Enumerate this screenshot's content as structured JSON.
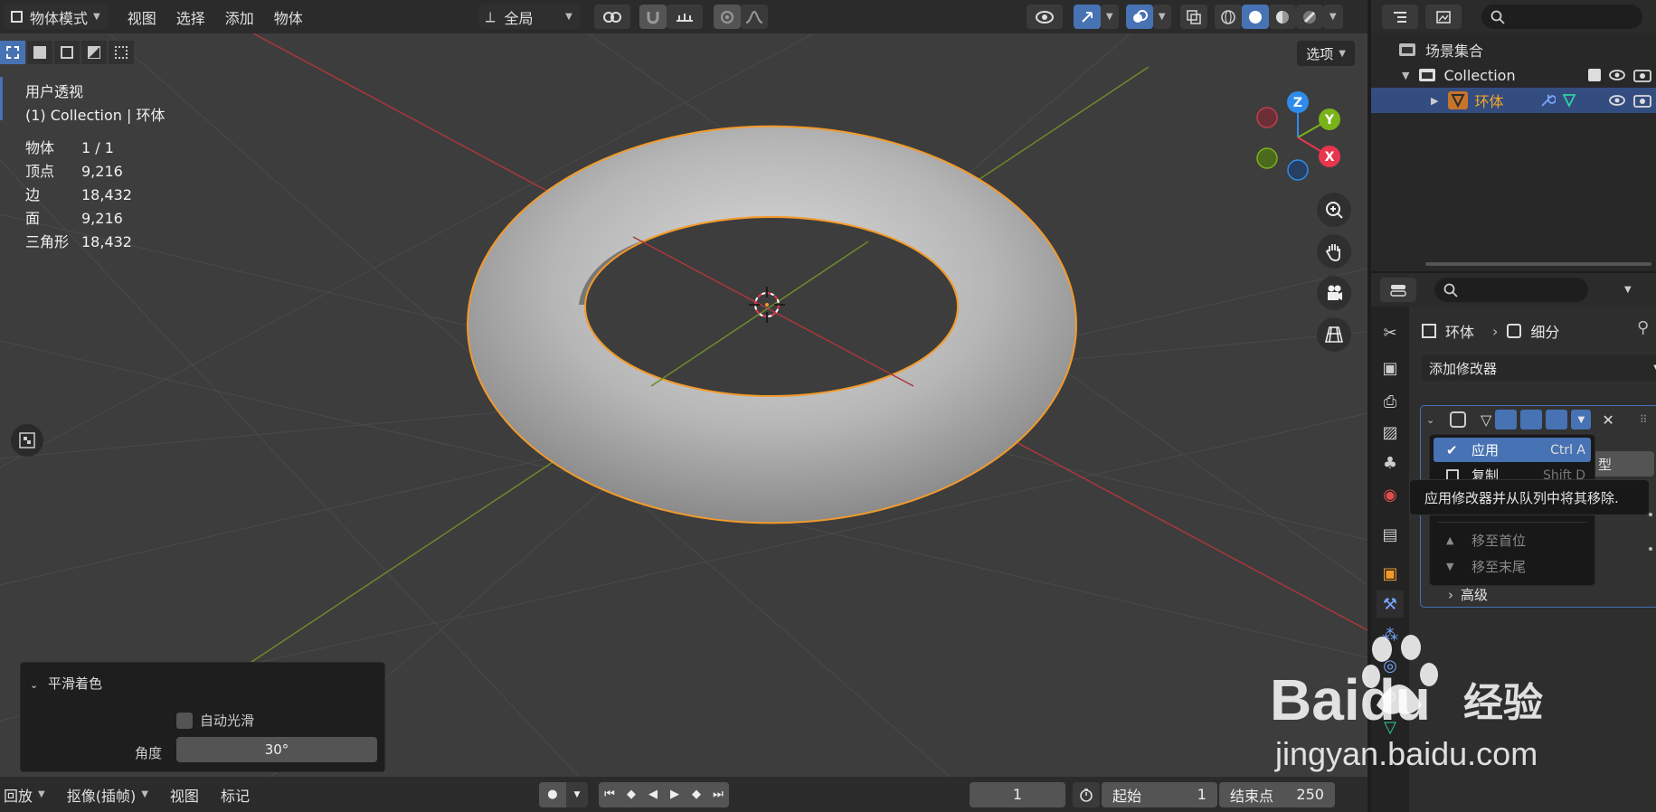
{
  "header": {
    "mode": "物体模式",
    "menus": [
      "视图",
      "选择",
      "添加",
      "物体"
    ],
    "transform_orientation": "全局",
    "options": "选项"
  },
  "viewport": {
    "view_name": "用户透视",
    "collection_line": "(1) Collection | 环体",
    "stats": [
      {
        "label": "物体",
        "value": "1 / 1"
      },
      {
        "label": "顶点",
        "value": "9,216"
      },
      {
        "label": "边",
        "value": "18,432"
      },
      {
        "label": "面",
        "value": "9,216"
      },
      {
        "label": "三角形",
        "value": "18,432"
      }
    ],
    "gizmo": {
      "x": "X",
      "y": "Y",
      "z": "Z"
    }
  },
  "smooth_panel": {
    "title": "平滑着色",
    "auto_smooth": "自动光滑",
    "angle_label": "角度",
    "angle_value": "30°"
  },
  "timeline": {
    "playback": "回放",
    "keying": "抠像(插帧)",
    "view": "视图",
    "marker": "标记",
    "current_frame": "1",
    "start_label": "起始",
    "start_value": "1",
    "end_label": "结束点",
    "end_value": "250"
  },
  "outliner": {
    "scene_collection": "场景集合",
    "collection": "Collection",
    "object": "环体"
  },
  "properties": {
    "breadcrumb_object": "环体",
    "breadcrumb_modifier": "细分",
    "add_modifier": "添加修改器",
    "partial_label": "型",
    "advanced": "高级"
  },
  "context_menu": {
    "items": [
      {
        "label": "应用",
        "shortcut": "Ctrl A"
      },
      {
        "label": "复制",
        "shortcut": "Shift D"
      },
      {
        "label": "移至首位",
        "shortcut": ""
      },
      {
        "label": "移至末尾",
        "shortcut": ""
      }
    ],
    "tooltip": "应用修改器并从队列中将其移除."
  },
  "watermark": {
    "brand": "Baidu",
    "brand_cn": "经验",
    "url": "jingyan.baidu.com"
  },
  "colors": {
    "accent": "#4772b3",
    "selection_outline": "#f39a2b",
    "axis_x": "#e8364f",
    "axis_y": "#7ab319",
    "axis_z": "#2d8ceb"
  }
}
